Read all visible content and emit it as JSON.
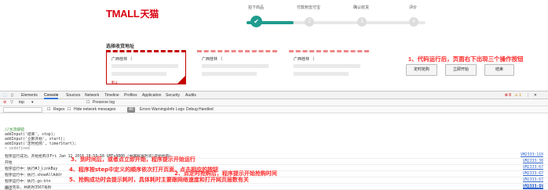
{
  "logo": {
    "text": "TMALL",
    "cn": "天猫"
  },
  "steps": [
    {
      "label": "拍下商品",
      "num": "✔",
      "done": true
    },
    {
      "label": "付款到支付宝",
      "num": "2",
      "done": false
    },
    {
      "label": "确认收货",
      "num": "3",
      "done": false
    },
    {
      "label": "评价",
      "num": "4",
      "done": false
    }
  ],
  "address": {
    "title": "选择收货地址",
    "cards": [
      {
        "head": "广西桂林 （",
        "tag": "默认",
        "active": true
      },
      {
        "head": "广西桂林 （",
        "tag": "",
        "active": false
      },
      {
        "head": "广西桂林 （",
        "tag": "",
        "active": false
      }
    ]
  },
  "annotations": {
    "a1": "1、代码运行后，页面右下出现三个操作按钮",
    "a2": "2、点定时抢购后，程序提示开始抢购时间",
    "a3": "3、到时间后，或者点立即开始，程序提示开始运行",
    "a4": "4、程序按step中定义的顺序依次打开页面，点击相应的按钮",
    "a5": "5、抢购成功时会提示耗时，具体耗时主要跟网络速度和打开网页层数有关"
  },
  "action_buttons": [
    {
      "label": "定时抢购"
    },
    {
      "label": "立即开始"
    },
    {
      "label": "结束"
    }
  ],
  "devtools": {
    "tabs": [
      "Elements",
      "Console",
      "Sources",
      "Network",
      "Timeline",
      "Profiles",
      "Application",
      "Security",
      "Audits"
    ],
    "active_tab": "Console",
    "context": "top",
    "preserve_log": "Preserve log",
    "filter": {
      "regex": "Regex",
      "hide_network": "Hide network messages",
      "levels": [
        "All",
        "Errors",
        "Warnings",
        "Info",
        "Logs",
        "Debug",
        "Handled"
      ]
    },
    "errors": "8",
    "warnings": "1",
    "code": [
      {
        "text": "//主流按钮",
        "comment": true
      },
      {
        "text": "addInput('结束', stop);",
        "comment": false
      },
      {
        "text": "addInput('立即开始', start);",
        "comment": false
      },
      {
        "text": "addInput('定时抢购', timerStart);",
        "comment": false
      },
      {
        "text": "< undefined",
        "comment": false
      }
    ],
    "logs": [
      {
        "text": "程序运行成功，开始抢购于Fri Jan 12 2018 10:59:58 GMT+0800 (中国标准时间)开始抢购~",
        "src": "VM2333:110"
      },
      {
        "text": "开始",
        "src": "VM2333:38"
      },
      {
        "text": "程序运行中：执行#J_LinkBuy",
        "src": "VM2333:67"
      },
      {
        "text": "程序运行中：执行.showAllAddr",
        "src": "VM2333:67"
      },
      {
        "text": "程序运行中：执行.go-btn",
        "src": "VM2333:67"
      },
      {
        "text": "运行完毕，共耗时3567毫秒",
        "src": "VM2333:89"
      },
      {
        "text": "停止",
        "src": "VM2333:94"
      }
    ]
  },
  "colors": {
    "brand": "#d8000f",
    "progress": "#1f9c8e",
    "annotation": "#ff2a2a",
    "link": "#3366cc"
  }
}
